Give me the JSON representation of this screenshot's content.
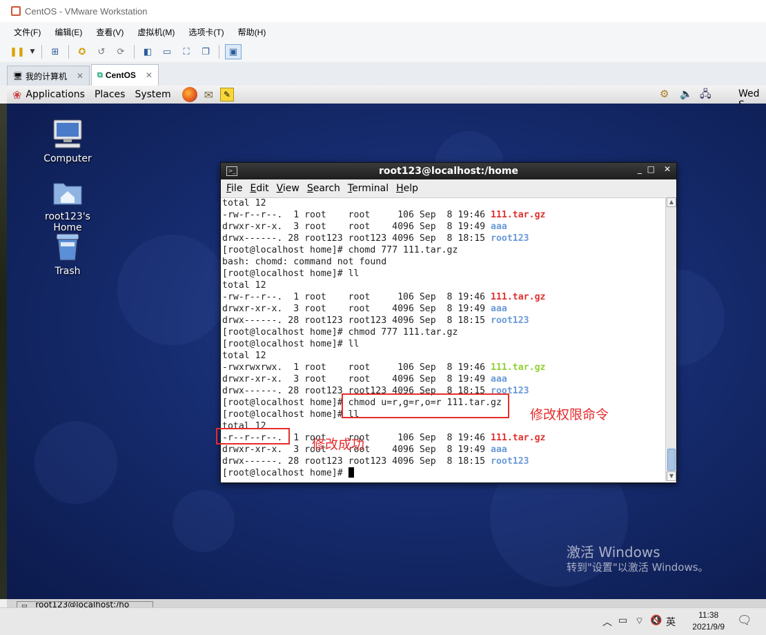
{
  "vmware": {
    "title": "CentOS - VMware Workstation",
    "menu": [
      "文件(F)",
      "编辑(E)",
      "查看(V)",
      "虚拟机(M)",
      "选项卡(T)",
      "帮助(H)"
    ],
    "tabs": [
      {
        "label": "我的计算机"
      },
      {
        "label": "CentOS"
      }
    ]
  },
  "gnome_panel": {
    "menus": [
      "Applications",
      "Places",
      "System"
    ],
    "clock_partial": "Wed S"
  },
  "desktop_icons": [
    {
      "label": "Computer"
    },
    {
      "label": "root123's Home"
    },
    {
      "label": "Trash"
    }
  ],
  "terminal": {
    "title": "root123@localhost:/home",
    "menu": [
      "File",
      "Edit",
      "View",
      "Search",
      "Terminal",
      "Help"
    ],
    "lines": [
      {
        "t": "total 12"
      },
      {
        "t": "-rw-r--r--.  1 root    root     106 Sep  8 19:46 ",
        "name": "111.tar.gz",
        "c": "red"
      },
      {
        "t": "drwxr-xr-x.  3 root    root    4096 Sep  8 19:49 ",
        "name": "aaa",
        "c": "blue"
      },
      {
        "t": "drwx------. 28 root123 root123 4096 Sep  8 18:15 ",
        "name": "root123",
        "c": "blue"
      },
      {
        "t": "[root@localhost home]# chomd 777 111.tar.gz"
      },
      {
        "t": "bash: chomd: command not found"
      },
      {
        "t": "[root@localhost home]# ll"
      },
      {
        "t": "total 12"
      },
      {
        "t": "-rw-r--r--.  1 root    root     106 Sep  8 19:46 ",
        "name": "111.tar.gz",
        "c": "red"
      },
      {
        "t": "drwxr-xr-x.  3 root    root    4096 Sep  8 19:49 ",
        "name": "aaa",
        "c": "blue"
      },
      {
        "t": "drwx------. 28 root123 root123 4096 Sep  8 18:15 ",
        "name": "root123",
        "c": "blue"
      },
      {
        "t": "[root@localhost home]# chmod 777 111.tar.gz"
      },
      {
        "t": "[root@localhost home]# ll"
      },
      {
        "t": "total 12"
      },
      {
        "t": "-rwxrwxrwx.  1 root    root     106 Sep  8 19:46 ",
        "name": "111.tar.gz",
        "c": "green"
      },
      {
        "t": "drwxr-xr-x.  3 root    root    4096 Sep  8 19:49 ",
        "name": "aaa",
        "c": "blue"
      },
      {
        "t": "drwx------. 28 root123 root123 4096 Sep  8 18:15 ",
        "name": "root123",
        "c": "blue"
      },
      {
        "t": "[root@localhost home]# chmod u=r,g=r,o=r 111.tar.gz"
      },
      {
        "t": "[root@localhost home]# ll"
      },
      {
        "t": "total 12"
      },
      {
        "t": "-r--r--r--.  1 root    root     106 Sep  8 19:46 ",
        "name": "111.tar.gz",
        "c": "red"
      },
      {
        "t": "drwxr-xr-x.  3 root    root    4096 Sep  8 19:49 ",
        "name": "aaa",
        "c": "blue"
      },
      {
        "t": "drwx------. 28 root123 root123 4096 Sep  8 18:15 ",
        "name": "root123",
        "c": "blue"
      },
      {
        "t": "[root@localhost home]# ",
        "cursor": true
      }
    ]
  },
  "annotations": {
    "command_note": "修改权限命令",
    "success_note": "修改成功"
  },
  "watermark": {
    "line1": "激活 Windows",
    "line2": "转到\"设置\"以激活 Windows。"
  },
  "guest_taskbar": {
    "item": "root123@localhost:/ho"
  },
  "windows_taskbar": {
    "ime": "英",
    "time": "11:38",
    "date": "2021/9/9"
  },
  "colors": {
    "red": "#e0302e",
    "green": "#8fd030",
    "blue": "#6a9ad8",
    "annotation": "#e52b2b"
  }
}
